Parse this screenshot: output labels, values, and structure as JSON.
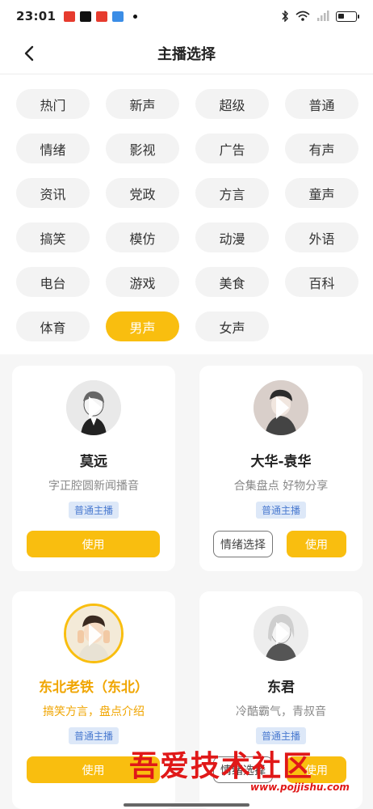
{
  "status_bar": {
    "time": "23:01"
  },
  "nav": {
    "title": "主播选择",
    "back_label": "back"
  },
  "tags": [
    {
      "label": "热门"
    },
    {
      "label": "新声"
    },
    {
      "label": "超级"
    },
    {
      "label": "普通"
    },
    {
      "label": "情绪"
    },
    {
      "label": "影视"
    },
    {
      "label": "广告"
    },
    {
      "label": "有声"
    },
    {
      "label": "资讯"
    },
    {
      "label": "党政"
    },
    {
      "label": "方言"
    },
    {
      "label": "童声"
    },
    {
      "label": "搞笑"
    },
    {
      "label": "模仿"
    },
    {
      "label": "动漫"
    },
    {
      "label": "外语"
    },
    {
      "label": "电台"
    },
    {
      "label": "游戏"
    },
    {
      "label": "美食"
    },
    {
      "label": "百科"
    },
    {
      "label": "体育"
    },
    {
      "label": "男声",
      "active": true
    },
    {
      "label": "女声"
    }
  ],
  "anchors": [
    {
      "name": "莫远",
      "desc": "字正腔圆新闻播音",
      "badge": "普通主播",
      "use_label": "使用"
    },
    {
      "name": "大华-袁华",
      "desc": "合集盘点 好物分享",
      "badge": "普通主播",
      "emotion_label": "情绪选择",
      "use_label": "使用"
    },
    {
      "name": "东北老铁（东北）",
      "desc": "搞笑方言，盘点介绍",
      "badge": "普通主播",
      "use_label": "使用",
      "highlighted": true
    },
    {
      "name": "东君",
      "desc": "冷酷霸气，青叔音",
      "badge": "普通主播",
      "emotion_label": "情绪选择",
      "use_label": "使用"
    }
  ],
  "watermark": {
    "text": "吾爱技术社区",
    "url": "www.pojjishu.com"
  },
  "colors": {
    "accent": "#f9be0f",
    "badge_bg": "#dde8f8",
    "badge_text": "#4b7bd0"
  }
}
